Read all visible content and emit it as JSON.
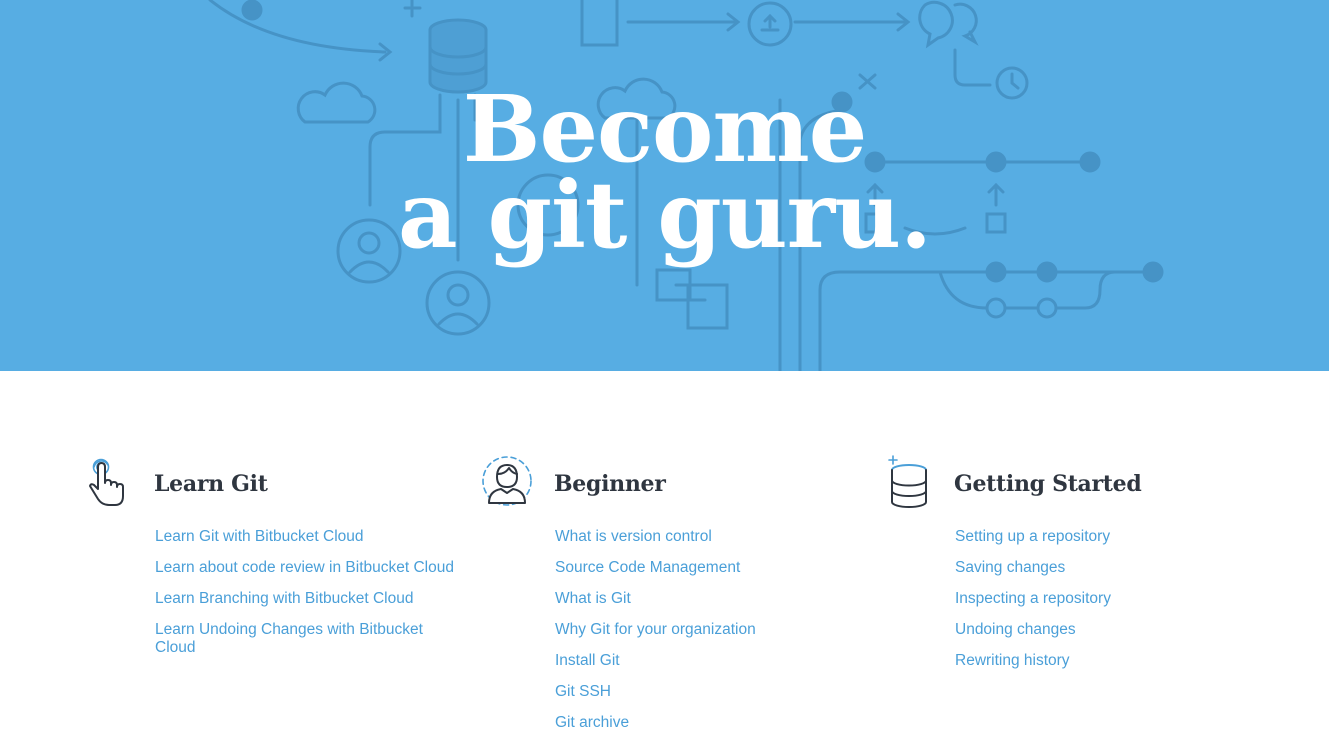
{
  "hero": {
    "title_line1": "Become",
    "title_line2": "a git guru.",
    "background_color": "#57ade3"
  },
  "sections": [
    {
      "icon": "pointer-hand-icon",
      "title": "Learn Git",
      "links": [
        "Learn Git with Bitbucket Cloud",
        "Learn about code review in Bitbucket Cloud",
        "Learn Branching with Bitbucket Cloud",
        "Learn Undoing Changes with Bitbucket Cloud"
      ]
    },
    {
      "icon": "user-avatar-icon",
      "title": "Beginner",
      "links": [
        "What is version control",
        "Source Code Management",
        "What is Git",
        "Why Git for your organization",
        "Install Git",
        "Git SSH",
        "Git archive"
      ]
    },
    {
      "icon": "database-stack-icon",
      "title": "Getting Started",
      "links": [
        "Setting up a repository",
        "Saving changes",
        "Inspecting a repository",
        "Undoing changes",
        "Rewriting history"
      ]
    }
  ],
  "colors": {
    "link": "#4a9fd8",
    "heading": "#2f3640",
    "hero_art": "#4a98cb"
  }
}
